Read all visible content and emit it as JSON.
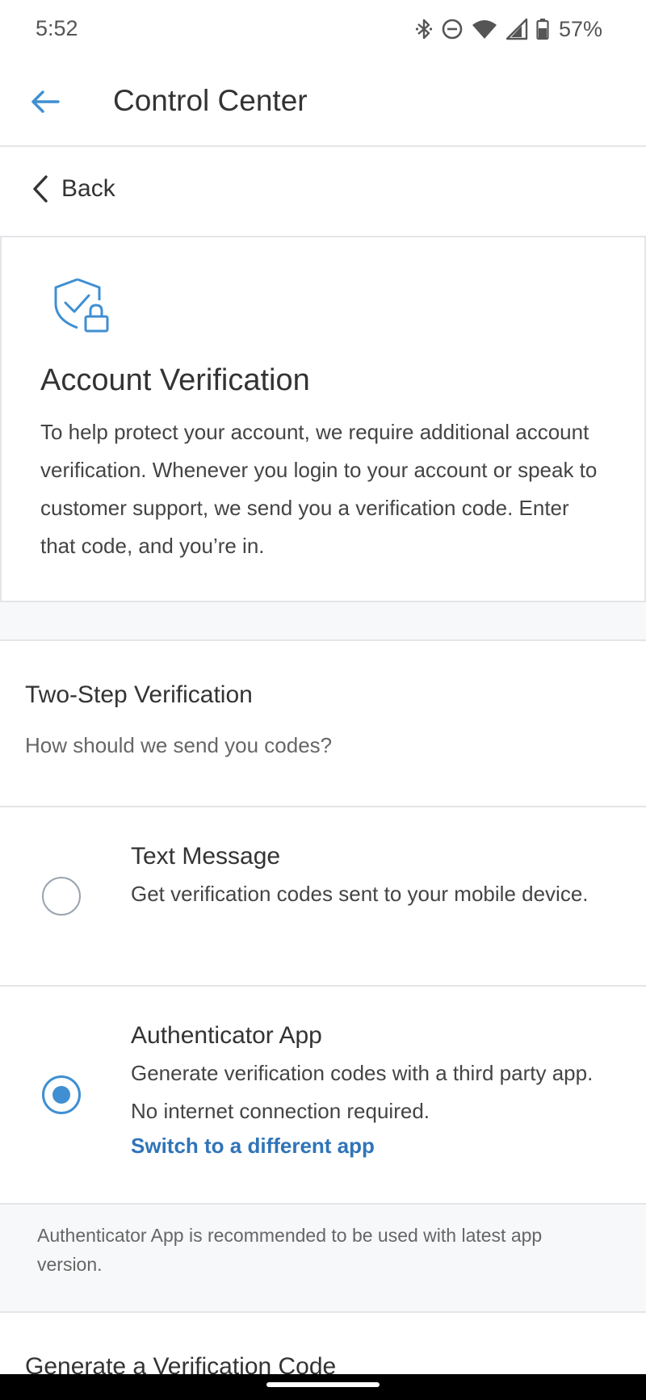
{
  "status_bar": {
    "time": "5:52",
    "battery": "57%",
    "icons": [
      "bluetooth-icon",
      "do-not-disturb-icon",
      "wifi-icon",
      "signal-icon",
      "battery-icon"
    ]
  },
  "app_bar": {
    "title": "Control Center",
    "back_icon": "arrow-left-icon",
    "accent_color": "#3f8fd2"
  },
  "back_row": {
    "label": "Back",
    "icon": "chevron-left-icon"
  },
  "account_verification": {
    "icon": "shield-lock-icon",
    "title": "Account Verification",
    "description": "To help protect your account, we require additional account verification. Whenever you login to your account or speak to customer support, we send you a verification code. Enter that code, and you’re in."
  },
  "two_step": {
    "title": "Two-Step Verification",
    "subtitle": "How should we send you codes?",
    "options": [
      {
        "title": "Text Message",
        "description": "Get verification codes sent to your mobile device.",
        "selected": false
      },
      {
        "title": "Authenticator App",
        "description": "Generate verification codes with a third party app. No internet connection required.",
        "link": "Switch to a different app",
        "selected": true
      }
    ],
    "note": "Authenticator App is recommended to be used with latest app version."
  },
  "generate": {
    "title": "Generate a Verification Code"
  }
}
